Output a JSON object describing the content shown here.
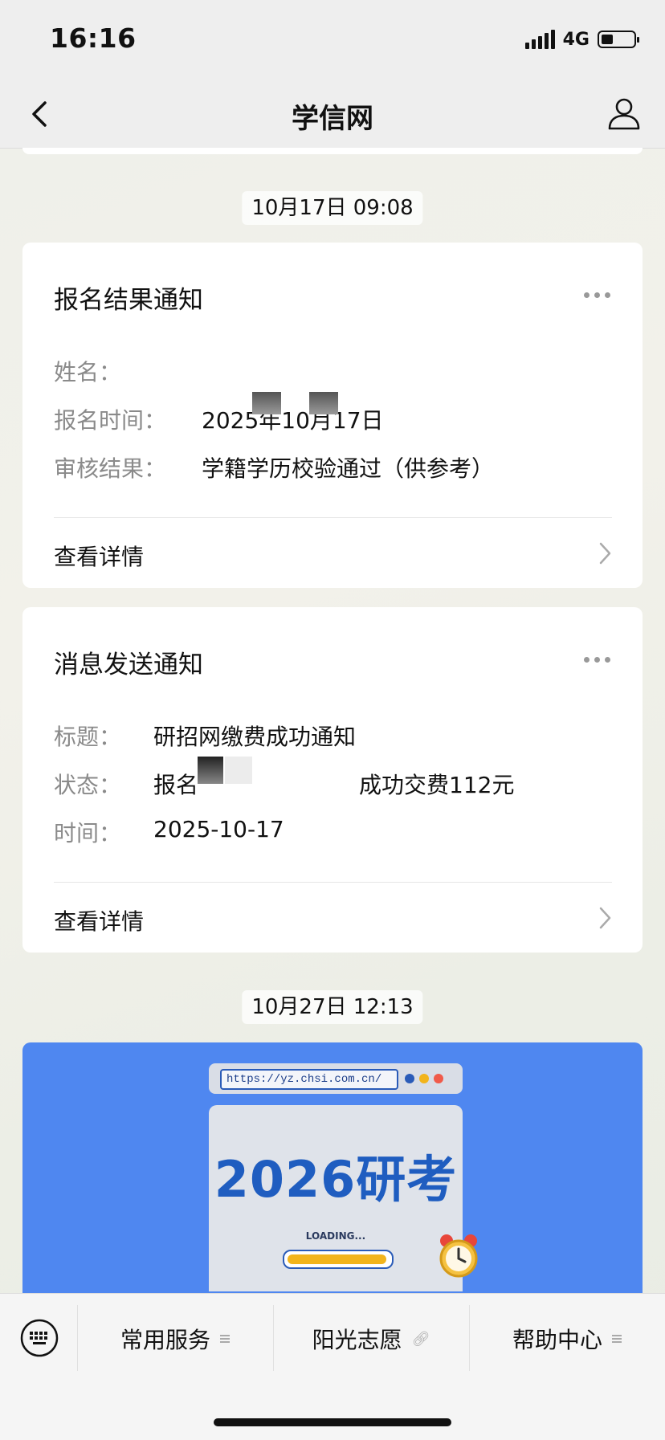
{
  "status_bar": {
    "time": "16:16",
    "network": "4G",
    "battery_level": 0.35
  },
  "nav": {
    "title": "学信网",
    "back_icon": "chevron-left-icon",
    "profile_icon": "person-icon"
  },
  "messages": {
    "date1": "10月17日 09:08",
    "card1": {
      "title": "报名结果通知",
      "name_label": "姓名：",
      "name_value": "",
      "time_label": "报名时间：",
      "time_value": "2025年10月17日",
      "result_label": "审核结果：",
      "result_value": "学籍学历校验通过（供参考）",
      "detail": "查看详情"
    },
    "card2": {
      "title": "消息发送通知",
      "subject_label": "标题：",
      "subject_value": "研招网缴费成功通知",
      "status_label": "状态：",
      "status_value_start": "报名",
      "status_value_end": "成功交费112元",
      "time_label": "时间：",
      "time_value": "2025-10-17",
      "detail": "查看详情"
    },
    "date2": "10月27日 12:13",
    "banner": {
      "url": "https://yz.chsi.com.cn/",
      "headline": "2026研考",
      "loading": "LOADING...",
      "progress": 0.92,
      "colors": {
        "background": "#4f87f0",
        "headline": "#1f5dc0",
        "progress": "#f2b41c"
      }
    }
  },
  "tab_bar": {
    "items": [
      {
        "label": "常用服务",
        "icon": "menu-icon"
      },
      {
        "label": "阳光志愿",
        "icon": "link-icon"
      },
      {
        "label": "帮助中心",
        "icon": "menu-icon"
      }
    ],
    "keyboard_icon": "keyboard-icon"
  }
}
